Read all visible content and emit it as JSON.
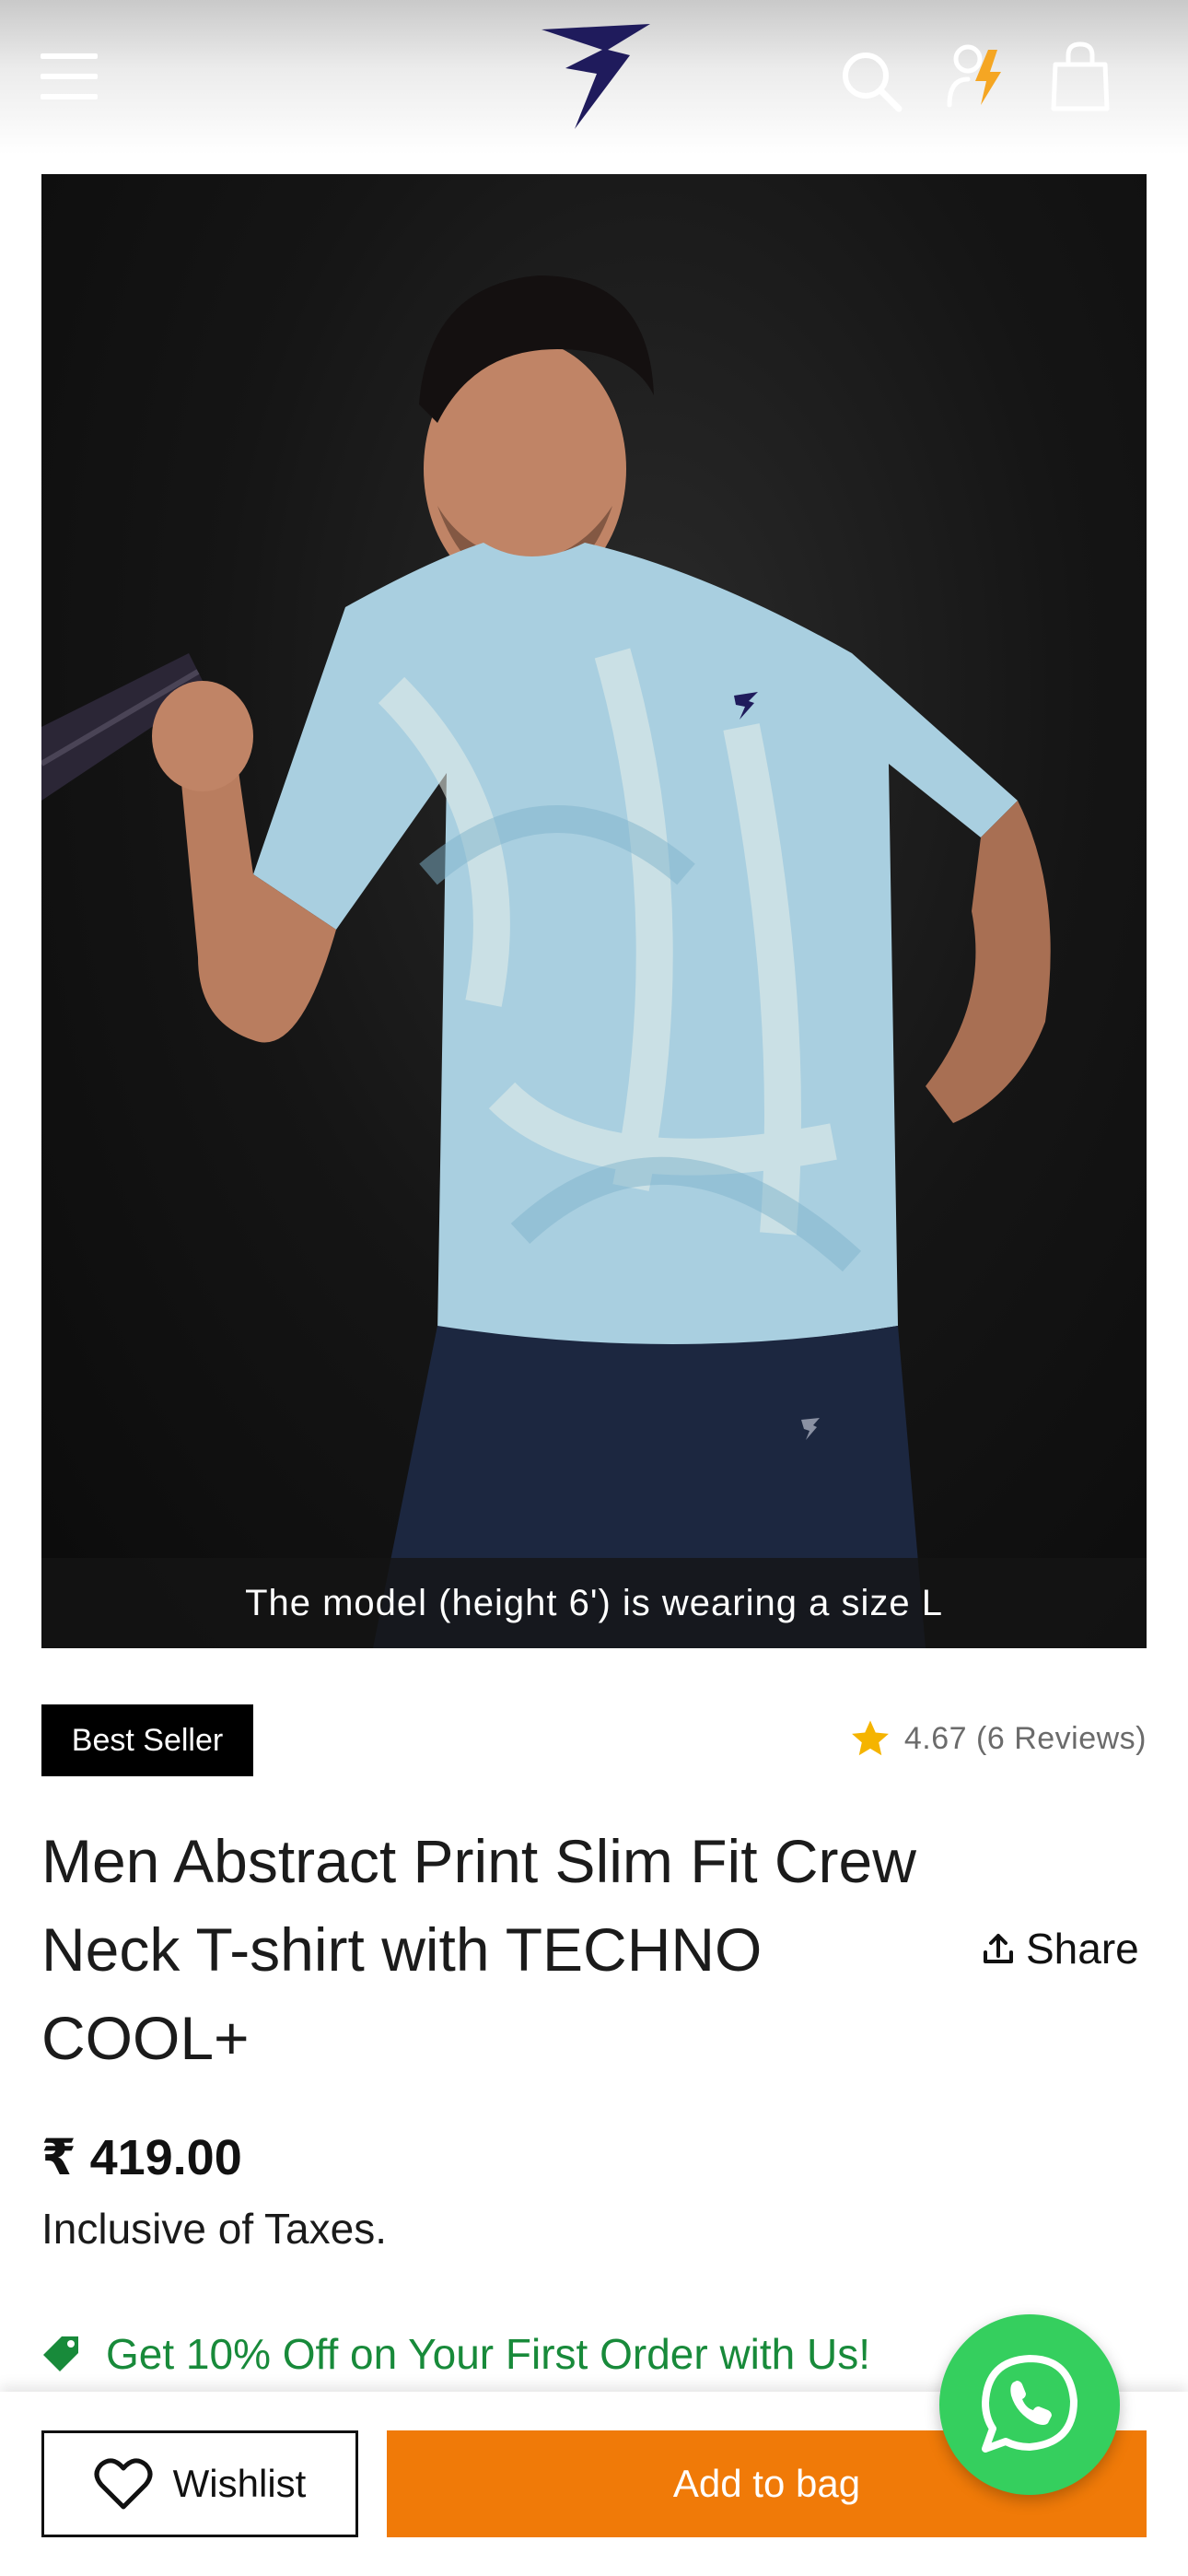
{
  "header": {
    "menu_icon": "hamburger-menu-icon",
    "logo_icon": "brand-logo-icon",
    "search_icon": "search-icon",
    "account_icon": "user-flash-icon",
    "bag_icon": "shopping-bag-icon",
    "colors": {
      "logo": "#1f1b5c",
      "flash": "#f5a623",
      "icons": "#ffffff"
    }
  },
  "product_image": {
    "caption": "The model (height 6') is wearing a size L"
  },
  "badge": {
    "label": "Best Seller"
  },
  "rating": {
    "value": "4.67",
    "reviews": "(6 Reviews)",
    "star_color": "#f5b400"
  },
  "product": {
    "title_lines": [
      "Men Abstract Print Slim Fit Crew",
      "Neck T-shirt with TECHNO",
      "COOL+"
    ],
    "share_label": "Share",
    "price": "₹ 419.00",
    "tax_note": "Inclusive of Taxes."
  },
  "offer": {
    "text": "Get 10% Off on Your First Order with Us!",
    "color": "#188a3a"
  },
  "actions": {
    "wishlist_label": "Wishlist",
    "add_to_bag_label": "Add to bag",
    "add_to_bag_color": "#f07a08"
  },
  "whatsapp": {
    "icon": "whatsapp-icon",
    "color": "#35cf5e"
  }
}
